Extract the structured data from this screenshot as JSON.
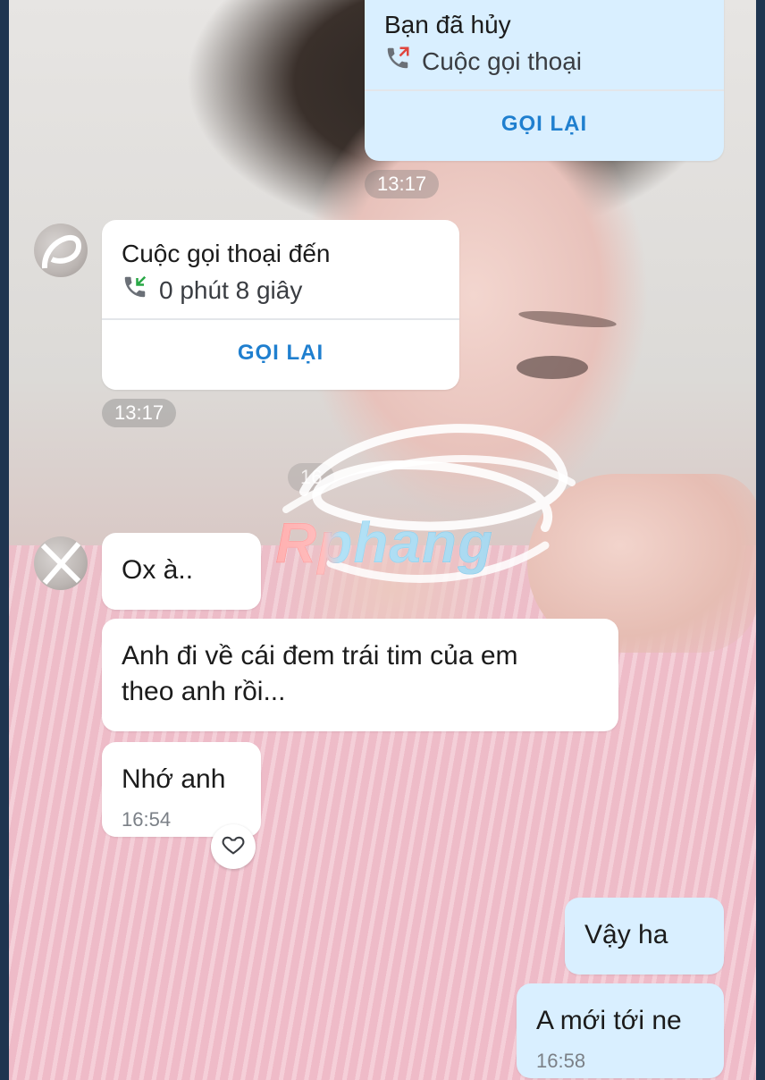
{
  "missed_call": {
    "title": "Bạn đã hủy",
    "subtitle": "Cuộc gọi thoại",
    "action": "GỌI LẠI",
    "time": "13:17"
  },
  "incoming_call": {
    "title": "Cuộc gọi thoại đến",
    "duration": "0 phút 8 giây",
    "action": "GỌI LẠI",
    "time": "13:17"
  },
  "partial_time": "16",
  "watermark": "Rphang",
  "messages_received": [
    {
      "text": "Ox à.."
    },
    {
      "text": "Anh đi về cái đem trái tim của em\ntheo anh rồi..."
    },
    {
      "text": "Nhớ anh",
      "time": "16:54"
    }
  ],
  "messages_sent": [
    {
      "text": "Vậy ha"
    },
    {
      "text": "A mới tới ne",
      "time": "16:58"
    }
  ],
  "icons": {
    "outgoing_call": "phone-outgoing-icon",
    "incoming_call": "phone-incoming-icon",
    "react": "heart-icon"
  },
  "colors": {
    "sent_bubble": "#d9efff",
    "received_bubble": "#ffffff",
    "action_blue": "#1f7fcf",
    "missed_red": "#e0463f",
    "incoming_green": "#28a745"
  }
}
